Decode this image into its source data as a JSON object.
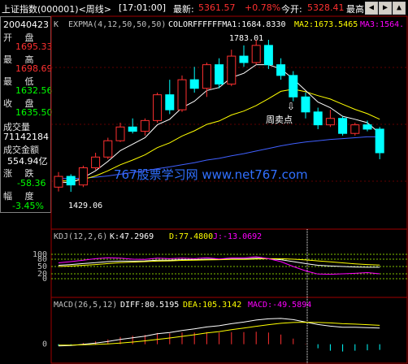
{
  "header": {
    "title": "上证指数(000001)<周线>",
    "time": "[17:01:00]",
    "latest_label": "最新:",
    "latest_value": "5361.57",
    "change_pct": "+0.78%",
    "open_label": "今开:",
    "open_value": "5328.41",
    "high_label": "最高:"
  },
  "info_panel": {
    "date": "20040423",
    "open_label": "开 盘",
    "open": "1695.33",
    "high_label": "最 高",
    "high": "1698.69",
    "low_label": "最 低",
    "low": "1632.56",
    "close_label": "收 盘",
    "close": "1635.50",
    "volume_label": "成交量",
    "volume": "71142184",
    "amount_label": "成交金额",
    "amount": "554.94亿",
    "change_label": "涨 跌",
    "change": "-58.36",
    "range_label": "幅 度",
    "range": "-3.45%"
  },
  "main_chart": {
    "k_label": "K",
    "indicator_line": "EXPMA(4,12,50,50,50)",
    "color_label": "COLORFFFFFFMA1:1684.8330",
    "ma2": "MA2:1673.5465",
    "ma3": "MA3:1564.",
    "peak_label": "1783.01",
    "trough_label": "1429.06",
    "sell_marker": "⇩",
    "sell_label": "周卖点",
    "watermark": "767股票学习网  www.net767.com",
    "colors": {
      "up": "#ff3030",
      "down": "#00ffff",
      "ma1": "#ffffff",
      "ma2": "#ffff00",
      "ma3": "#ff00ff",
      "ma4": "#4060ff"
    }
  },
  "chart_data": [
    {
      "type": "candlestick",
      "title": "",
      "ylim": [
        1380,
        1800
      ],
      "candles": [
        {
          "o": 1440,
          "h": 1475,
          "l": 1430,
          "c": 1465
        },
        {
          "o": 1465,
          "h": 1470,
          "l": 1429,
          "c": 1445
        },
        {
          "o": 1445,
          "h": 1490,
          "l": 1440,
          "c": 1485
        },
        {
          "o": 1485,
          "h": 1520,
          "l": 1480,
          "c": 1510
        },
        {
          "o": 1510,
          "h": 1555,
          "l": 1505,
          "c": 1548
        },
        {
          "o": 1548,
          "h": 1590,
          "l": 1545,
          "c": 1580
        },
        {
          "o": 1580,
          "h": 1600,
          "l": 1565,
          "c": 1570
        },
        {
          "o": 1570,
          "h": 1600,
          "l": 1560,
          "c": 1595
        },
        {
          "o": 1595,
          "h": 1660,
          "l": 1590,
          "c": 1655
        },
        {
          "o": 1655,
          "h": 1690,
          "l": 1610,
          "c": 1620
        },
        {
          "o": 1620,
          "h": 1700,
          "l": 1615,
          "c": 1690
        },
        {
          "o": 1690,
          "h": 1720,
          "l": 1660,
          "c": 1670
        },
        {
          "o": 1670,
          "h": 1730,
          "l": 1650,
          "c": 1725
        },
        {
          "o": 1725,
          "h": 1740,
          "l": 1670,
          "c": 1680
        },
        {
          "o": 1680,
          "h": 1760,
          "l": 1675,
          "c": 1745
        },
        {
          "o": 1745,
          "h": 1770,
          "l": 1720,
          "c": 1730
        },
        {
          "o": 1730,
          "h": 1783,
          "l": 1725,
          "c": 1770
        },
        {
          "o": 1770,
          "h": 1783,
          "l": 1715,
          "c": 1725
        },
        {
          "o": 1725,
          "h": 1740,
          "l": 1690,
          "c": 1700
        },
        {
          "o": 1700,
          "h": 1710,
          "l": 1640,
          "c": 1650
        },
        {
          "o": 1650,
          "h": 1660,
          "l": 1600,
          "c": 1615
        },
        {
          "o": 1615,
          "h": 1625,
          "l": 1575,
          "c": 1585
        },
        {
          "o": 1585,
          "h": 1620,
          "l": 1580,
          "c": 1600
        },
        {
          "o": 1600,
          "h": 1605,
          "l": 1560,
          "c": 1565
        },
        {
          "o": 1565,
          "h": 1590,
          "l": 1560,
          "c": 1585
        },
        {
          "o": 1585,
          "h": 1595,
          "l": 1570,
          "c": 1575
        },
        {
          "o": 1575,
          "h": 1580,
          "l": 1505,
          "c": 1520
        }
      ],
      "ma1": [
        1452,
        1450,
        1462,
        1478,
        1500,
        1525,
        1540,
        1555,
        1585,
        1598,
        1625,
        1640,
        1665,
        1672,
        1695,
        1705,
        1725,
        1725,
        1715,
        1692,
        1665,
        1638,
        1625,
        1605,
        1598,
        1590,
        1565
      ],
      "ma2": [
        1455,
        1454,
        1458,
        1466,
        1478,
        1492,
        1503,
        1515,
        1532,
        1543,
        1559,
        1571,
        1586,
        1594,
        1608,
        1617,
        1630,
        1646,
        1663,
        1668,
        1662,
        1653,
        1645,
        1633,
        1621,
        1611,
        1598
      ],
      "ma4": [
        1460,
        1460,
        1461,
        1463,
        1466,
        1470,
        1474,
        1478,
        1483,
        1487,
        1492,
        1497,
        1503,
        1507,
        1513,
        1518,
        1524,
        1530,
        1536,
        1541,
        1545,
        1548,
        1551,
        1553,
        1555,
        1557,
        1557
      ]
    },
    {
      "type": "line",
      "title": "KDJ(12,2,6)",
      "ylim": [
        -50,
        130
      ],
      "ticks": [
        100,
        80,
        50,
        20,
        0
      ],
      "series": [
        {
          "name": "K",
          "value_label": "K:47.2969",
          "values": [
            55,
            58,
            62,
            66,
            70,
            72,
            72,
            73,
            76,
            76,
            78,
            78,
            80,
            79,
            81,
            81,
            84,
            82,
            78,
            70,
            62,
            55,
            52,
            50,
            48,
            47,
            47
          ]
        },
        {
          "name": "D",
          "value_label": "D:77.4800",
          "values": [
            50,
            52,
            55,
            58,
            62,
            66,
            68,
            70,
            72,
            73,
            75,
            76,
            77,
            78,
            79,
            79,
            81,
            82,
            82,
            80,
            77,
            73,
            69,
            65,
            61,
            58,
            56
          ]
        },
        {
          "name": "J",
          "value_label": "J:-13.0692",
          "values": [
            65,
            70,
            76,
            82,
            86,
            84,
            80,
            79,
            84,
            82,
            84,
            82,
            86,
            81,
            85,
            85,
            90,
            82,
            70,
            50,
            32,
            19,
            18,
            20,
            22,
            25,
            20
          ]
        }
      ]
    },
    {
      "type": "bar",
      "title": "MACD(26,5,12)",
      "ylim": [
        -90,
        160
      ],
      "ticks": [
        0
      ],
      "series": [
        {
          "name": "DIFF",
          "value_label": "DIFF:80.5195",
          "values": [
            -8,
            -6,
            0,
            6,
            14,
            24,
            32,
            40,
            52,
            58,
            68,
            76,
            86,
            92,
            102,
            110,
            120,
            126,
            128,
            122,
            110,
            98,
            90,
            84,
            84,
            82,
            80
          ]
        },
        {
          "name": "DEA",
          "value_label": "DEA:105.3142",
          "values": [
            -4,
            -4,
            -3,
            -1,
            2,
            6,
            11,
            17,
            24,
            31,
            39,
            47,
            56,
            63,
            72,
            80,
            89,
            97,
            104,
            108,
            109,
            108,
            106,
            102,
            100,
            97,
            94
          ]
        },
        {
          "name": "MACD",
          "value_label": "MACD:-49.5894",
          "values": [
            -8,
            -4,
            6,
            14,
            24,
            36,
            42,
            46,
            56,
            54,
            58,
            58,
            60,
            58,
            60,
            60,
            62,
            58,
            48,
            28,
            2,
            -20,
            -32,
            -36,
            -32,
            -30,
            -28
          ]
        }
      ]
    }
  ]
}
